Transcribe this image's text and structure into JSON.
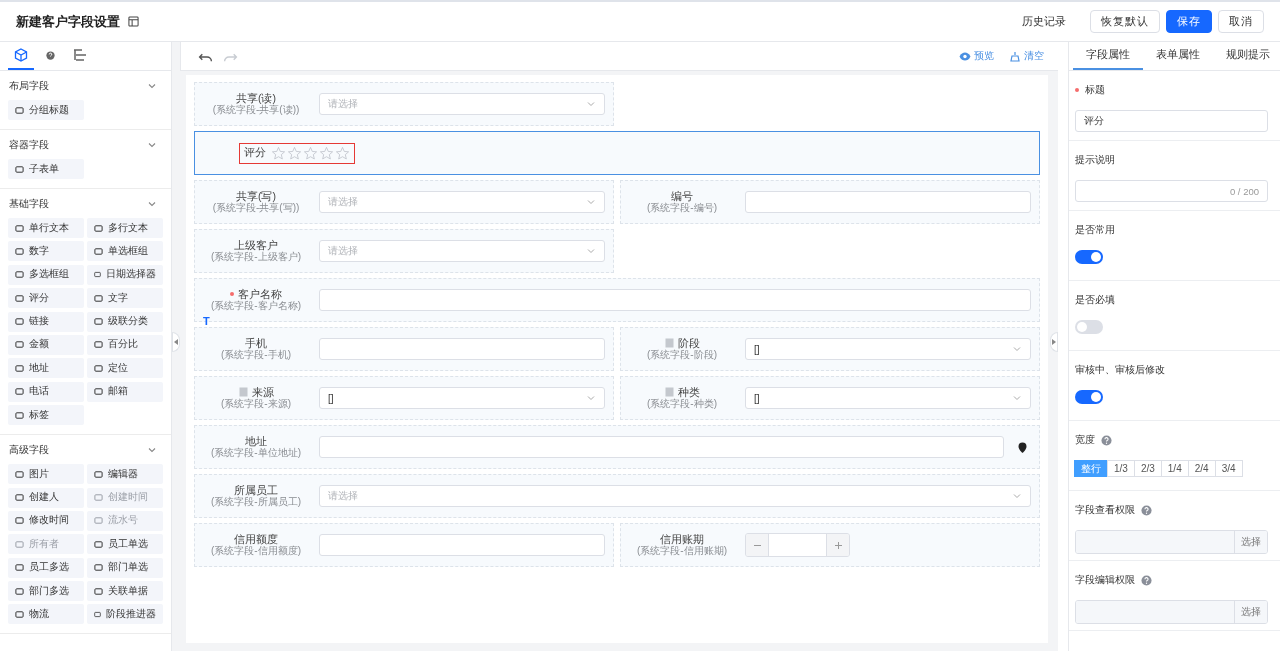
{
  "header": {
    "title": "新建客户字段设置",
    "buttons": [
      {
        "label": "历史记录",
        "kind": "text"
      },
      {
        "label": "恢复默认",
        "kind": "default"
      },
      {
        "label": "保存",
        "kind": "primary"
      },
      {
        "label": "取消",
        "kind": "default"
      }
    ]
  },
  "sidebar": {
    "tabs": [
      {
        "selected": true
      },
      {
        "selected": false
      },
      {
        "selected": false
      }
    ],
    "groups": [
      {
        "title": "布局字段",
        "expanded": true,
        "items": [
          {
            "label": "分组标题",
            "disabled": false
          }
        ]
      },
      {
        "title": "容器字段",
        "expanded": true,
        "items": [
          {
            "label": "子表单",
            "disabled": false
          }
        ]
      },
      {
        "title": "基础字段",
        "expanded": true,
        "items": [
          {
            "label": "单行文本",
            "disabled": false
          },
          {
            "label": "多行文本",
            "disabled": false
          },
          {
            "label": "数字",
            "disabled": false
          },
          {
            "label": "单选框组",
            "disabled": false
          },
          {
            "label": "多选框组",
            "disabled": false
          },
          {
            "label": "日期选择器",
            "disabled": false
          },
          {
            "label": "评分",
            "disabled": false
          },
          {
            "label": "文字",
            "disabled": false
          },
          {
            "label": "链接",
            "disabled": false
          },
          {
            "label": "级联分类",
            "disabled": false
          },
          {
            "label": "金额",
            "disabled": false
          },
          {
            "label": "百分比",
            "disabled": false
          },
          {
            "label": "地址",
            "disabled": false
          },
          {
            "label": "定位",
            "disabled": false
          },
          {
            "label": "电话",
            "disabled": false
          },
          {
            "label": "邮箱",
            "disabled": false
          },
          {
            "label": "标签",
            "disabled": false
          }
        ]
      },
      {
        "title": "高级字段",
        "expanded": true,
        "items": [
          {
            "label": "图片",
            "disabled": false
          },
          {
            "label": "编辑器",
            "disabled": false
          },
          {
            "label": "创建人",
            "disabled": false
          },
          {
            "label": "创建时间",
            "disabled": true
          },
          {
            "label": "修改时间",
            "disabled": false
          },
          {
            "label": "流水号",
            "disabled": true
          },
          {
            "label": "所有者",
            "disabled": true
          },
          {
            "label": "员工单选",
            "disabled": false
          },
          {
            "label": "员工多选",
            "disabled": false
          },
          {
            "label": "部门单选",
            "disabled": false
          },
          {
            "label": "部门多选",
            "disabled": false
          },
          {
            "label": "关联单据",
            "disabled": false
          },
          {
            "label": "物流",
            "disabled": false
          },
          {
            "label": "阶段推进器",
            "disabled": false
          }
        ]
      }
    ]
  },
  "canvas": {
    "history": [
      {
        "disabled": false
      },
      {
        "disabled": true
      }
    ],
    "actions": [
      {
        "label": "预览"
      },
      {
        "label": "清空"
      }
    ],
    "rows": [
      {
        "fields": [
          {
            "kind": "select",
            "full_width": false,
            "label": "共享(读)",
            "sublabel": "(系统字段-共享(读))",
            "required": false,
            "locked": false,
            "selected": false,
            "placeholder": "请选择"
          }
        ]
      },
      {
        "fields": [
          {
            "kind": "rating",
            "full_width": true,
            "label": "评分",
            "required": false,
            "locked": false,
            "selected": true,
            "stars": 0
          }
        ]
      },
      {
        "fields": [
          {
            "kind": "select",
            "full_width": false,
            "label": "共享(写)",
            "sublabel": "(系统字段-共享(写))",
            "required": false,
            "locked": false,
            "selected": false,
            "placeholder": "请选择"
          },
          {
            "kind": "input",
            "full_width": false,
            "label": "编号",
            "sublabel": "(系统字段-编号)",
            "required": false,
            "locked": false,
            "selected": false
          }
        ]
      },
      {
        "fields": [
          {
            "kind": "select",
            "full_width": false,
            "label": "上级客户",
            "sublabel": "(系统字段-上级客户)",
            "required": false,
            "locked": false,
            "selected": false,
            "placeholder": "请选择"
          }
        ]
      },
      {
        "fields": [
          {
            "kind": "input",
            "full_width": true,
            "label": "客户名称",
            "sublabel": "(系统字段-客户名称)",
            "required": true,
            "locked": false,
            "selected": false,
            "marker": "T"
          }
        ]
      },
      {
        "fields": [
          {
            "kind": "input",
            "full_width": false,
            "label": "手机",
            "sublabel": "(系统字段-手机)",
            "required": false,
            "locked": false,
            "selected": false
          },
          {
            "kind": "select",
            "full_width": false,
            "label": "阶段",
            "sublabel": "(系统字段-阶段)",
            "required": false,
            "locked": true,
            "selected": false,
            "value": "[]"
          }
        ]
      },
      {
        "fields": [
          {
            "kind": "select",
            "full_width": false,
            "label": "来源",
            "sublabel": "(系统字段-来源)",
            "required": false,
            "locked": true,
            "selected": false,
            "value": "[]"
          },
          {
            "kind": "select",
            "full_width": false,
            "label": "种类",
            "sublabel": "(系统字段-种类)",
            "required": false,
            "locked": true,
            "selected": false,
            "value": "[]"
          }
        ]
      },
      {
        "fields": [
          {
            "kind": "address",
            "full_width": true,
            "label": "地址",
            "sublabel": "(系统字段-单位地址)",
            "required": false,
            "locked": false,
            "selected": false
          }
        ]
      },
      {
        "fields": [
          {
            "kind": "select",
            "full_width": true,
            "label": "所属员工",
            "sublabel": "(系统字段-所属员工)",
            "required": false,
            "locked": false,
            "selected": false,
            "placeholder": "请选择"
          }
        ]
      },
      {
        "fields": [
          {
            "kind": "input",
            "full_width": false,
            "label": "信用额度",
            "sublabel": "(系统字段-信用额度)",
            "required": false,
            "locked": false,
            "selected": false
          },
          {
            "kind": "stepper",
            "full_width": false,
            "label": "信用账期",
            "sublabel": "(系统字段-信用账期)",
            "required": false,
            "locked": false,
            "selected": false
          }
        ]
      }
    ]
  },
  "panel": {
    "tabs": [
      {
        "label": "字段属性",
        "selected": true
      },
      {
        "label": "表单属性",
        "selected": false
      },
      {
        "label": "规则提示",
        "selected": false
      }
    ],
    "props": [
      {
        "kind": "input",
        "label": "标题",
        "required": true,
        "help": false,
        "value": "评分"
      },
      {
        "kind": "textarea",
        "label": "提示说明",
        "required": false,
        "help": false,
        "counter": "0 / 200"
      },
      {
        "kind": "switch",
        "label": "是否常用",
        "required": false,
        "help": false,
        "on": true
      },
      {
        "kind": "switch",
        "label": "是否必填",
        "required": false,
        "help": false,
        "on": false
      },
      {
        "kind": "switch",
        "label": "审核中、审核后修改",
        "required": false,
        "help": false,
        "on": true
      },
      {
        "kind": "segmented",
        "label": "宽度",
        "required": false,
        "help": true,
        "options": [
          {
            "label": "整行",
            "selected": true
          },
          {
            "label": "1/3",
            "selected": false
          },
          {
            "label": "2/3",
            "selected": false
          },
          {
            "label": "1/4",
            "selected": false
          },
          {
            "label": "2/4",
            "selected": false
          },
          {
            "label": "3/4",
            "selected": false
          }
        ]
      },
      {
        "kind": "picker",
        "label": "字段查看权限",
        "required": false,
        "help": true,
        "button": "选择"
      },
      {
        "kind": "picker",
        "label": "字段编辑权限",
        "required": false,
        "help": true,
        "button": "选择"
      }
    ]
  }
}
